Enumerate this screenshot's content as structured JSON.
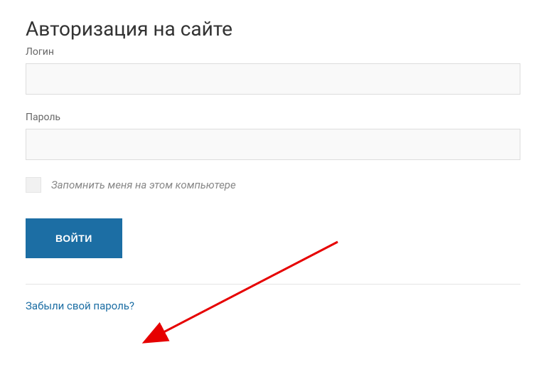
{
  "title": "Авторизация на сайте",
  "fields": {
    "login": {
      "label": "Логин",
      "value": ""
    },
    "password": {
      "label": "Пароль",
      "value": ""
    }
  },
  "remember": {
    "label": "Запомнить меня на этом компьютере"
  },
  "submit": {
    "label": "Войти"
  },
  "forgot": {
    "label": "Забыли свой пароль?"
  }
}
